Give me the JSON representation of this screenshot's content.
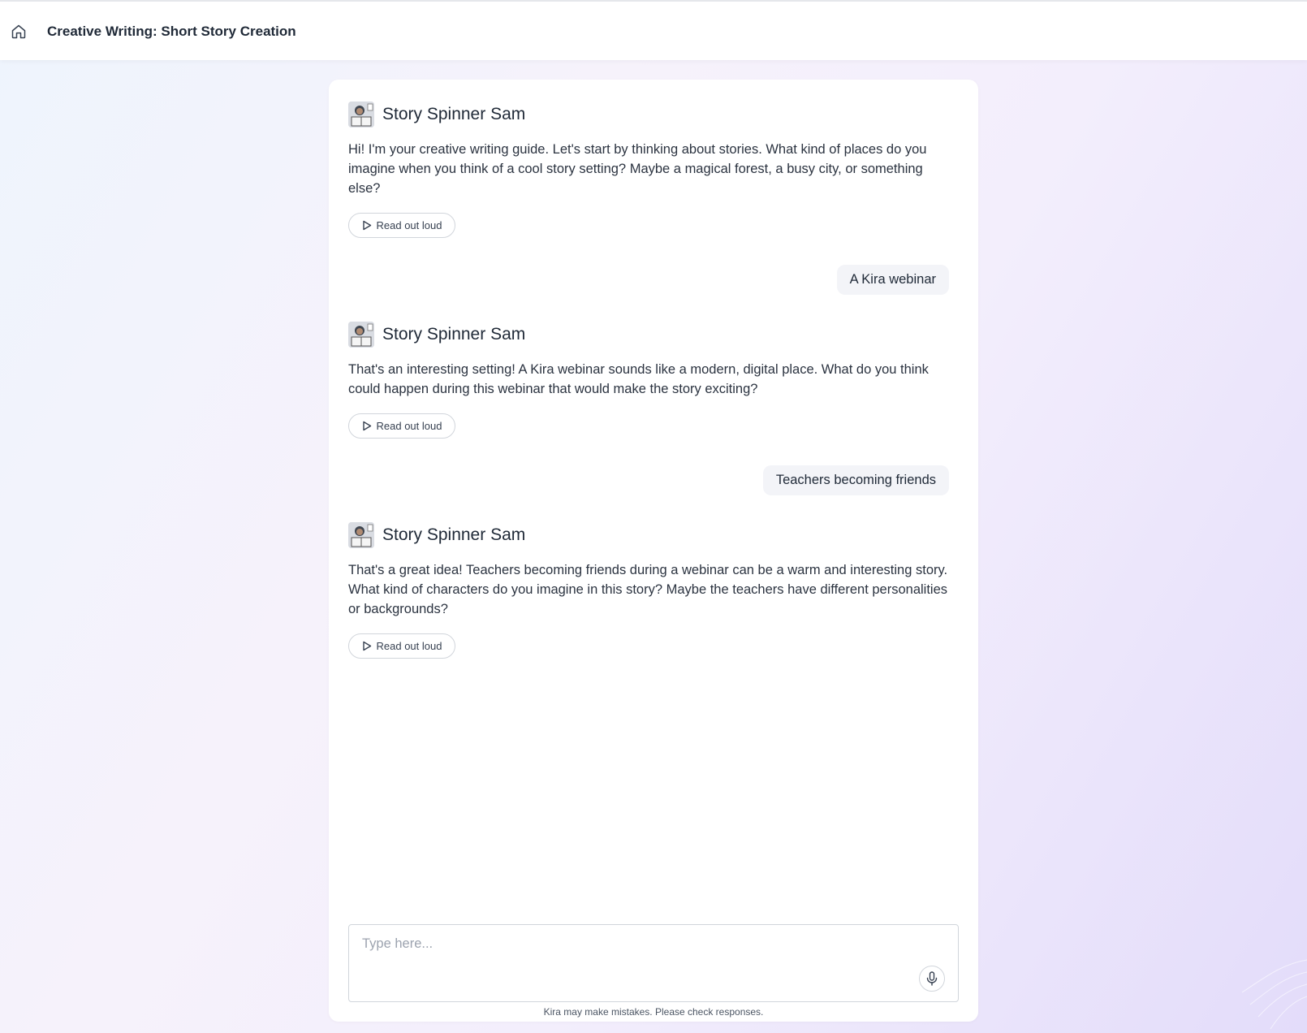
{
  "header": {
    "home_icon": "home-icon",
    "title": "Creative Writing: Short Story Creation"
  },
  "messages": [
    {
      "role": "bot",
      "name": "Story Spinner Sam",
      "text": "Hi! I'm your creative writing guide. Let's start by thinking about stories. What kind of places do you imagine when you think of a cool story setting? Maybe a magical forest, a busy city, or something else?",
      "read_label": "Read out loud"
    },
    {
      "role": "user",
      "text": "A Kira webinar"
    },
    {
      "role": "bot",
      "name": "Story Spinner Sam",
      "text": "That's an interesting setting! A Kira webinar sounds like a modern, digital place. What do you think could happen during this webinar that would make the story exciting?",
      "read_label": "Read out loud"
    },
    {
      "role": "user",
      "text": "Teachers becoming friends"
    },
    {
      "role": "bot",
      "name": "Story Spinner Sam",
      "text": "That's a great idea! Teachers becoming friends during a webinar can be a warm and interesting story. What kind of characters do you imagine in this story? Maybe the teachers have different personalities or backgrounds?",
      "read_label": "Read out loud"
    }
  ],
  "composer": {
    "placeholder": "Type here...",
    "value": "",
    "mic_icon": "microphone-icon"
  },
  "disclaimer": "Kira may make mistakes. Please check responses.",
  "colors": {
    "panel": "#ffffff",
    "user_bubble": "#f3f4f8",
    "border": "#d1d5db"
  }
}
